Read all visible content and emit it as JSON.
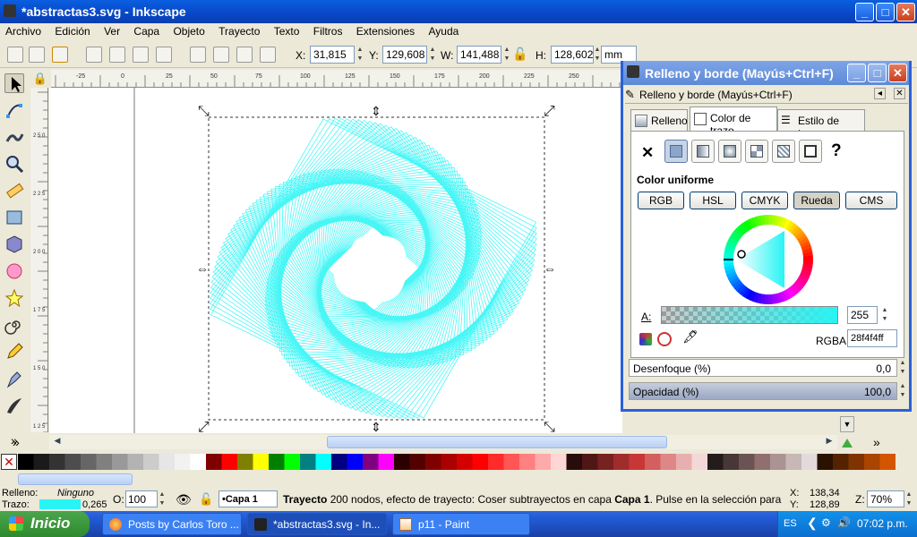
{
  "window": {
    "title": "*abstractas3.svg - Inkscape",
    "min": "_",
    "max": "□",
    "close": "✕"
  },
  "menu": [
    "Archivo",
    "Edición",
    "Ver",
    "Capa",
    "Objeto",
    "Trayecto",
    "Texto",
    "Filtros",
    "Extensiones",
    "Ayuda"
  ],
  "toolbar": {
    "x_label": "X:",
    "x_value": "31,815",
    "y_label": "Y:",
    "y_value": "129,608",
    "w_label": "W:",
    "w_value": "141,488",
    "h_label": "H:",
    "h_value": "128,602",
    "unit": "mm"
  },
  "ruler_h_ticks": [
    "-25",
    "0",
    "25",
    "50",
    "75",
    "100",
    "125",
    "150",
    "175",
    "200",
    "225",
    "250"
  ],
  "ruler_v_ticks": [
    "2 5 0",
    "2 2 5",
    "2 0 0",
    "1 7 5",
    "1 5 0",
    "1 2 5"
  ],
  "dialog": {
    "title": "Relleno y borde (Mayús+Ctrl+F)",
    "subtitle": "Relleno y borde (Mayús+Ctrl+F)",
    "tabs": [
      "Relleno",
      "Color de trazo",
      "Estilo de trazo"
    ],
    "selected_tab": "Color de trazo",
    "section_label": "Color uniforme",
    "modes": [
      "RGB",
      "HSL",
      "CMYK",
      "Rueda",
      "CMS"
    ],
    "selected_mode": "Rueda",
    "alpha_label": "A:",
    "alpha_value": "255",
    "rgba_label": "RGBA:",
    "rgba_value": "28f4f4ff",
    "blur_label": "Desenfoque (%)",
    "blur_value": "0,0",
    "opacity_label": "Opacidad (%)",
    "opacity_value": "100,0",
    "opacity_level": 1.0,
    "stroke_color": "#28f4f4"
  },
  "status": {
    "fill_label": "Relleno:",
    "fill_value": "Ninguno",
    "stroke_label": "Trazo:",
    "stroke_width": "0,265",
    "o_label": "O:",
    "o_value": "100",
    "layer": "•Capa 1",
    "message_bold": "Trayecto",
    "message": " 200 nodos, efecto de trayecto: Coser subtrayectos en capa ",
    "message_layer": "Capa 1",
    "message_tail": ". Pulse en la selección para conmut...",
    "coord_x_label": "X:",
    "coord_x": "138,34",
    "coord_y_label": "Y:",
    "coord_y": "128,89",
    "zoom_label": "Z:",
    "zoom_value": "70%"
  },
  "taskbar": {
    "start": "Inicio",
    "tasks": [
      "Posts by Carlos Toro ...",
      "*abstractas3.svg - In...",
      "p11 - Paint"
    ],
    "lang": "ES",
    "time": "07:02 p.m."
  },
  "colors": {
    "accent": "#28f4f4",
    "title_blue": "#0a5fe0",
    "taskbar_blue": "#245edb",
    "start_green": "#3a9a3a"
  }
}
